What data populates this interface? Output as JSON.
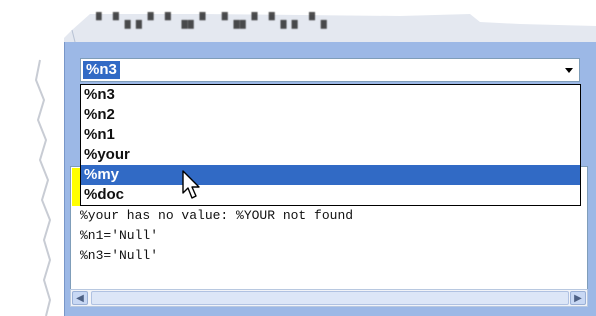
{
  "combo": {
    "value": "%n3"
  },
  "dropdown": {
    "items": [
      "%n3",
      "%n2",
      "%n1",
      "%your",
      "%my",
      "%doc"
    ],
    "selected_index": 4
  },
  "output": {
    "lines": [
      "%your has no value: %YOUR not found",
      "%n1='Null'",
      "%n3='Null'"
    ]
  },
  "colors": {
    "selection": "#316ac5",
    "window_frame": "#9cb8e6",
    "highlight_marker": "#ffff00"
  },
  "icons": {
    "combo_arrow": "chevron-down-icon",
    "scroll_left": "arrow-left-icon",
    "scroll_right": "arrow-right-icon",
    "pointer": "mouse-pointer-icon"
  }
}
